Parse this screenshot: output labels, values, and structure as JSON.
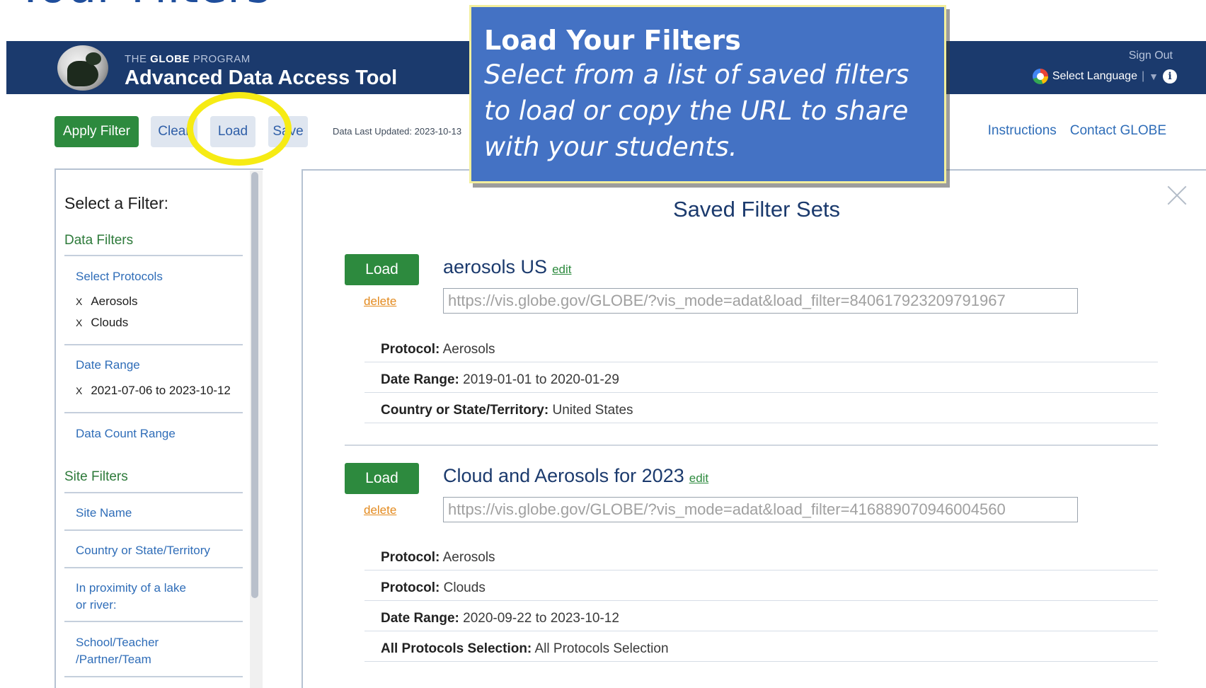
{
  "slide": {
    "title": "d Your Filters"
  },
  "header": {
    "program_prefix": "THE",
    "program_brand": "GLOBE",
    "program_suffix": "PROGRAM",
    "app_title": "Advanced Data Access Tool",
    "sign_out": "Sign Out",
    "language": "Select Language"
  },
  "toolbar": {
    "apply": "Apply Filter",
    "clear": "Clear",
    "load": "Load",
    "save": "Save",
    "data_updated": "Data Last Updated:  2023-10-13",
    "instructions": "Instructions",
    "contact": "Contact GLOBE"
  },
  "callout": {
    "title": "Load Your Filters",
    "body": "Select from a list of saved filters to load or copy the URL to share with your students."
  },
  "sidebar": {
    "title": "Select a Filter:",
    "data_filters": "Data Filters",
    "select_protocols": "Select Protocols",
    "protocols": [
      "Aerosols",
      "Clouds"
    ],
    "date_range": "Date Range",
    "date_value": "2021-07-06 to 2023-10-12",
    "data_count_range": "Data Count Range",
    "site_filters": "Site Filters",
    "site_name": "Site Name",
    "country": "Country or State/Territory",
    "proximity_1": "In proximity of a lake",
    "proximity_2": "or river:",
    "school_1": "School/Teacher",
    "school_2": "/Partner/Team"
  },
  "modal": {
    "title": "Saved Filter Sets",
    "load_label": "Load",
    "edit_label": "edit",
    "delete_label": "delete",
    "sets": [
      {
        "name": "aerosols US",
        "url": "https://vis.globe.gov/GLOBE/?vis_mode=adat&load_filter=840617923209791967",
        "rows": [
          {
            "label": "Protocol:",
            "value": "Aerosols"
          },
          {
            "label": "Date Range:",
            "value": "2019-01-01 to 2020-01-29"
          },
          {
            "label": "Country or State/Territory:",
            "value": "United States"
          }
        ]
      },
      {
        "name": "Cloud and Aerosols for 2023",
        "url": "https://vis.globe.gov/GLOBE/?vis_mode=adat&load_filter=416889070946004560",
        "rows": [
          {
            "label": "Protocol:",
            "value": "Aerosols"
          },
          {
            "label": "Protocol:",
            "value": "Clouds"
          },
          {
            "label": "Date Range:",
            "value": "2020-09-22 to 2023-10-12"
          },
          {
            "label": "All Protocols Selection:",
            "value": "All Protocols Selection"
          }
        ]
      }
    ]
  }
}
